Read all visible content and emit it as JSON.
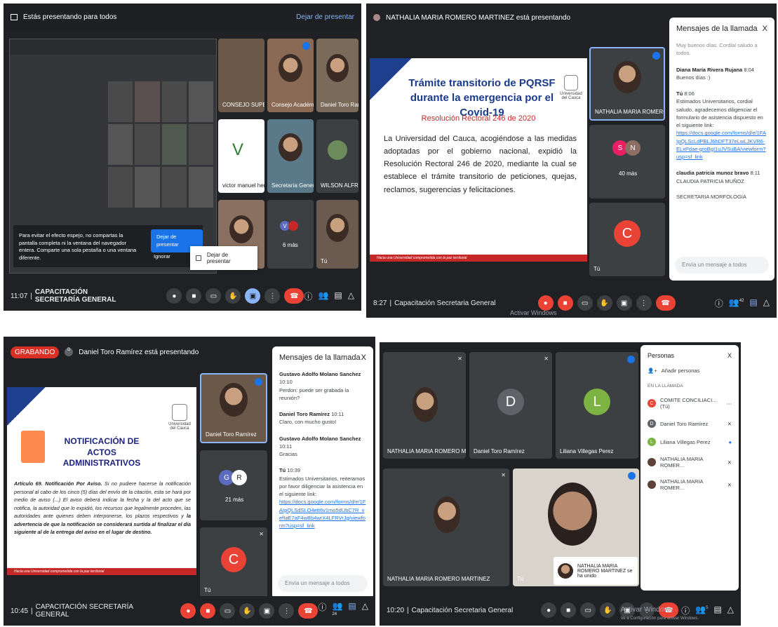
{
  "p1": {
    "banner": "Estás presentando para todos",
    "stop": "Dejar de presentar",
    "tiles": [
      "CONSEJO SUPERIOR",
      "Consejo Académico",
      "Daniel Toro Ramírez",
      "victor manuel herrer...",
      "Secretaría General",
      "WILSON ALFREDO B...",
      "",
      "6 más",
      "Tú"
    ],
    "warning": "Para evitar el efecto espejo, no compartas la pantalla completa ni la ventana del navegador entera. Comparte una sola pestaña o una ventana diferente.",
    "warn_btn": "Dejar de presentar",
    "ignore": "Ignorar",
    "popup": "Dejar de presentar",
    "time": "11:07",
    "meeting": "CAPACITACIÓN SECRETARÍA GENERAL"
  },
  "p2": {
    "banner": "NATHALIA MARIA ROMERO MARTINEZ está presentando",
    "slide_title": "Trámite transitorio de PQRSF durante la emergencia por el Covid-19",
    "slide_sub": "Resolución Rectoral 246 de 2020",
    "slide_body": "La Universidad del Cauca, acogiéndose a las medidas adoptadas por el gobierno nacional, expidió la Resolución Rectoral 246 de 2020, mediante la cual se establece el trámite transitorio de peticiones, quejas, reclamos, sugerencias y felicitaciones.",
    "slide_footer": "Hacia una Universidad comprometida con la paz territorial",
    "emblem": "Universidad del Cauca",
    "tile_name": "NATHALIA MARIA ROMERO MAR...",
    "more": "40 más",
    "me": "Tú",
    "me_initial": "C",
    "chat_title": "Mensajes de la llamada",
    "chat_close": "X",
    "m0": "Muy buenos días. Cordial saludo a todos.",
    "m1_who": "Diana María Rivera Rujana",
    "m1_time": "8:04",
    "m1": "Buenos días :)",
    "m2_who": "Tú",
    "m2_time": "8:06",
    "m2": "Estimados Universitarios, cordial saludo, agradecemos diligenciar el formulario de asistencia dispuesto en el siguiente link:",
    "m2_link": "https://docs.google.com/forms/d/e/1FAIpQLScLdPBLJ6hDFT37eLwLJKVR6-ELxPdae-groBgI1uJVSuBA/viewform?usp=sf_link",
    "m3_who": "claudia patricia munoz bravo",
    "m3_time": "8:11",
    "m3": "CLAUDIA PATRICIA MUÑOZ",
    "m3b": "SECRETARIA MORFOLOGIA",
    "input": "Envía un mensaje a todos",
    "time": "8:27",
    "meeting": "Capacitación Secretaria General",
    "watermark": "Activar Windows",
    "count": "42"
  },
  "p3": {
    "rec": "GRABANDO",
    "banner": "Daniel Toro Ramírez está presentando",
    "slide_title": "NOTIFICACIÓN DE ACTOS ADMINISTRATIVOS",
    "emblem": "Universidad del Cauca",
    "slide_body_lead": "Artículo 69. Notificación Por Aviso.",
    "slide_body": " Si no pudiere hacerse la notificación personal al cabo de los cinco (5) días del envío de la citación, esta se hará por medio de aviso (...) El aviso deberá indicar la fecha y la del acto que se notifica, la autoridad que lo expidió, los recursos que legalmente proceden, las autoridades ante quienes deben interponerse, los plazos respectivos y ",
    "slide_body_bold": "la advertencia de que la notificación se considerará surtida al finalizar el día siguiente al de la entrega del aviso en el lugar de destino.",
    "slide_footer": "Hacia una Universidad comprometida con la paz territorial",
    "tile_name": "Daniel Toro Ramírez",
    "more": "21 más",
    "me": "Tú",
    "me_initial": "C",
    "chat_title": "Mensajes de la llamada",
    "chat_close": "X",
    "m1_who": "Gustavo Adolfo Molano Sanchez",
    "m1_time": "10:10",
    "m1": "Perdon: puede ser grabada la reunión?",
    "m2_who": "Daniel Toro Ramírez",
    "m2_time": "10:11",
    "m2": "Claro, con mucho gusto!",
    "m3_who": "Gustavo Adolfo Molano Sanchez",
    "m3_time": "10:11",
    "m3": "Gracias",
    "m4_who": "Tú",
    "m4_time": "10:39",
    "m4": "Estimados Universitarios, reiteramos por favor diligenciar la asistencia en el siguiente link:",
    "m4_link": "https://docs.google.com/forms/d/e/1FAIpQLSdSLO4ett6v1mo5dUbC7R_vefIaE7aF4wBb4wrX4LFRVrJg/viewform?usp=sf_link",
    "input": "Envía un mensaje a todos",
    "time": "10:45",
    "meeting": "CAPACITACIÓN SECRETARÍA GENERAL",
    "count": "24"
  },
  "p4": {
    "tiles": [
      "NATHALIA MARIA ROMERO MARTINEZ",
      "Daniel Toro Ramírez",
      "Liliana Villegas Perez",
      "NATHALIA MARIA ROMERO MARTINEZ",
      "Tú"
    ],
    "d_initial": "D",
    "l_initial": "L",
    "toast": "NATHALIA MARIA ROMERO MARTINEZ se ha unido",
    "people_title": "Personas",
    "people_close": "X",
    "add": "Añadir personas",
    "in_call": "EN LA LLAMADA",
    "persons": [
      "COMITE CONCILIACI... (Tú)",
      "Daniel Toro Ramírez",
      "Liliana Villegas Perez",
      "NATHALIA MARIA ROMER...",
      "NATHALIA MARIA ROMER..."
    ],
    "initials": [
      "C",
      "D",
      "L",
      "",
      ""
    ],
    "time": "10:20",
    "meeting": "Capacitación Secretaria General",
    "watermark": "Activar Windows",
    "watermark2": "Ve a Configuración para activar Windows.",
    "count": "5",
    "colors": {
      "c": "#ea4335",
      "d": "#5f6368",
      "l": "#7cb342"
    }
  }
}
